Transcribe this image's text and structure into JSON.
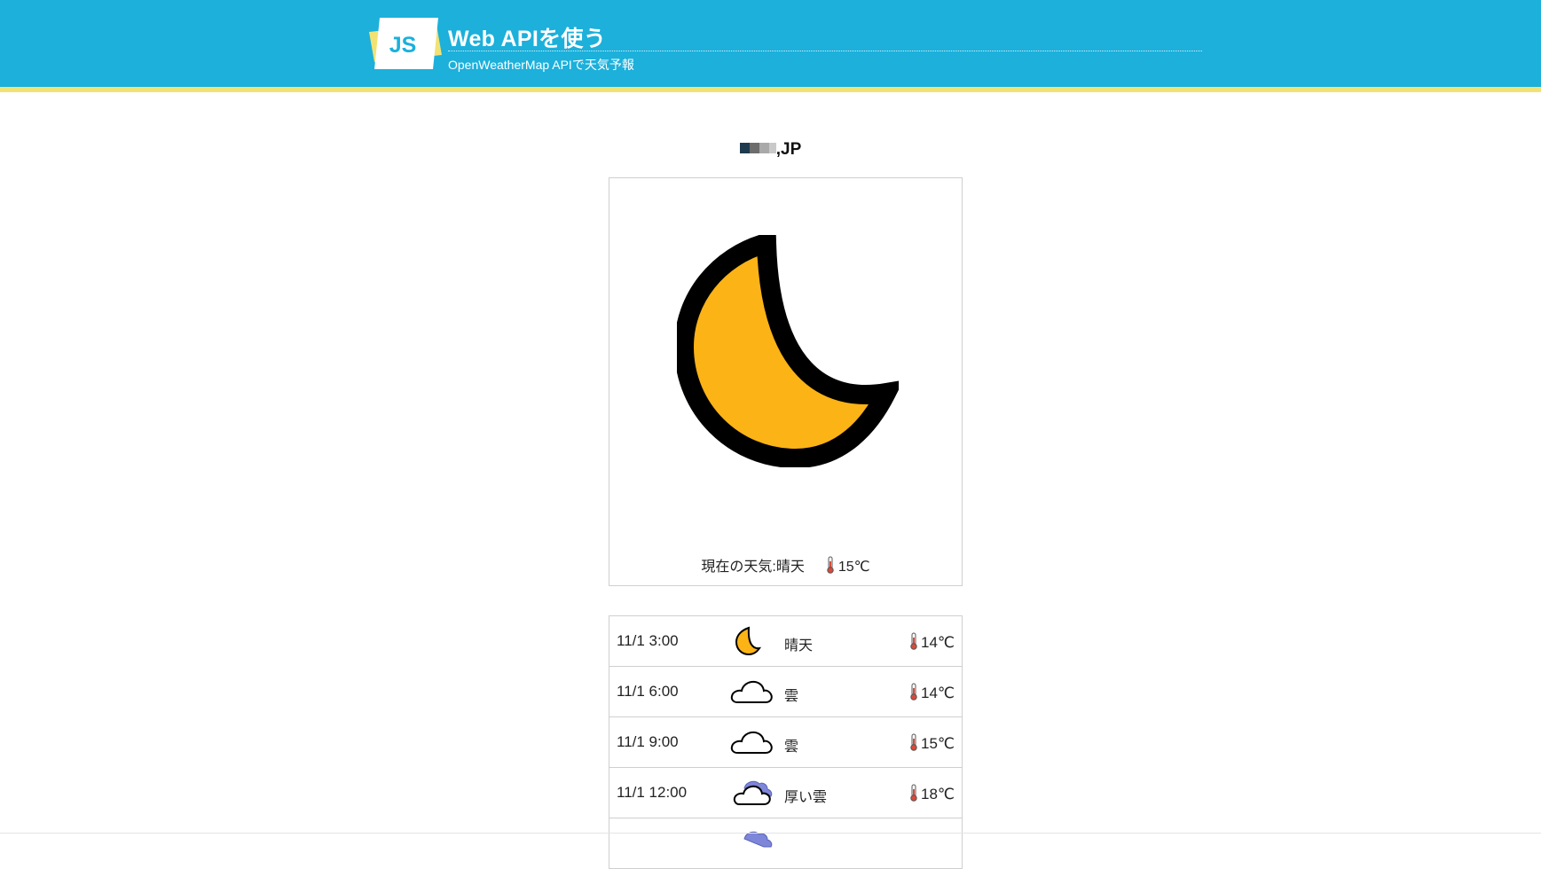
{
  "header": {
    "logo_text": "JS",
    "title": "Web APIを使う",
    "subtitle": "OpenWeatherMap APIで天気予報"
  },
  "location": {
    "country_suffix": ",JP"
  },
  "current": {
    "label": "現在の天気:",
    "condition": "晴天",
    "temperature": "15℃",
    "icon": "crescent-moon-icon"
  },
  "forecast": [
    {
      "time": "11/1 3:00",
      "icon": "crescent-moon-icon",
      "condition": "晴天",
      "temperature": "14℃"
    },
    {
      "time": "11/1 6:00",
      "icon": "cloud-icon",
      "condition": "雲",
      "temperature": "14℃"
    },
    {
      "time": "11/1 9:00",
      "icon": "cloud-icon",
      "condition": "雲",
      "temperature": "15℃"
    },
    {
      "time": "11/1 12:00",
      "icon": "thick-cloud-icon",
      "condition": "厚い雲",
      "temperature": "18℃"
    }
  ],
  "colors": {
    "header_bg": "#1cb0db",
    "header_stripe": "#f2e274",
    "moon_fill": "#fbb316",
    "thermometer": "#d94a3a"
  }
}
